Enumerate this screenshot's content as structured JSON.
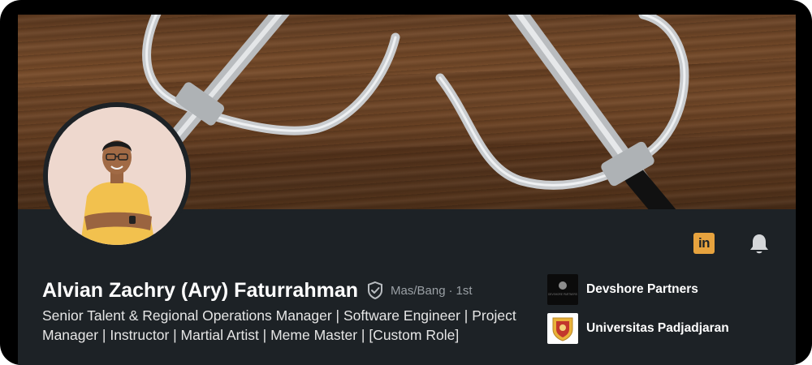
{
  "profile": {
    "name": "Alvian Zachry (Ary) Faturrahman",
    "pronouns": "Mas/Bang",
    "separator": "·",
    "connection_degree": "1st",
    "headline": "Senior Talent & Regional Operations Manager | Software Engineer | Project Manager | Instructor | Martial Artist | Meme Master | [Custom Role]"
  },
  "actions": {
    "linkedin_label": "in"
  },
  "organizations": [
    {
      "name": "Devshore Partners",
      "logo_text": "DEVSHORE PARTNERS"
    },
    {
      "name": "Universitas Padjadjaran"
    }
  ],
  "icons": {
    "verified": "shield-check-icon",
    "linkedin": "linkedin-icon",
    "notification": "bell-icon"
  },
  "colors": {
    "card_bg": "#1d2226",
    "text_primary": "#ffffff",
    "text_secondary": "#9aa0a5",
    "linkedin_accent": "#e7a33e"
  }
}
